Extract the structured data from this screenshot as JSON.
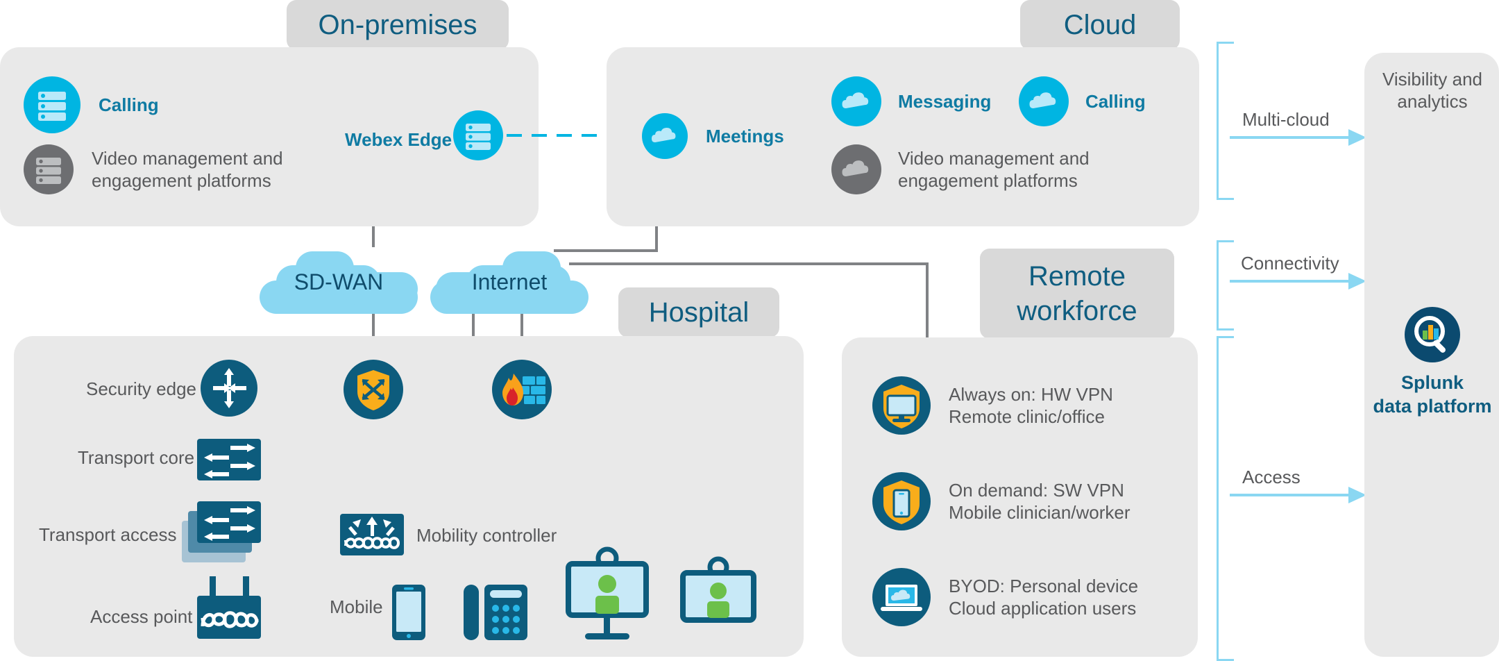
{
  "diagram": {
    "title_colors": {
      "tab_bg": "#d9d9d9",
      "panel_bg": "#e9e9e9",
      "tab_text": "#0f5d80",
      "accent_cyan": "#00b5e2",
      "light_cyan": "#8ad7f2",
      "cisco_blue": "#0d5c7d",
      "gray_text": "#58595b",
      "teal_text": "#0f7ba3",
      "orange": "#f9ad1b",
      "green": "#6cc04a",
      "connector_gray": "#808285",
      "splunk_navy": "#0b4a6f"
    }
  },
  "onprem": {
    "tab_label": "On-premises",
    "items": [
      {
        "label": "Calling",
        "icon": "server-cyan-icon",
        "style": "teal"
      },
      {
        "label": "Video management and\nengagement platforms",
        "icon": "server-gray-icon",
        "style": "gray"
      }
    ],
    "edge": {
      "label": "Webex Edge",
      "icon": "server-cyan-icon"
    }
  },
  "cloud": {
    "tab_label": "Cloud",
    "meetings": {
      "label": "Meetings",
      "icon": "cloud-cyan-icon"
    },
    "items": [
      {
        "label": "Messaging",
        "icon": "cloud-cyan-icon",
        "style": "teal"
      },
      {
        "label": "Calling",
        "icon": "cloud-cyan-icon",
        "style": "teal"
      },
      {
        "label": "Video management and\nengagement platforms",
        "icon": "cloud-gray-icon",
        "style": "gray"
      }
    ]
  },
  "network_clouds": [
    {
      "label": "SD-WAN",
      "icon": "network-cloud-icon"
    },
    {
      "label": "Internet",
      "icon": "network-cloud-icon"
    }
  ],
  "hospital": {
    "tab_label": "Hospital",
    "layers": [
      {
        "label": "Security edge",
        "icon": "router-icon"
      },
      {
        "label": "Transport core",
        "icon": "switch-icon"
      },
      {
        "label": "Transport access",
        "icon": "switch-stack-icon"
      },
      {
        "label": "Access point",
        "icon": "access-point-icon"
      }
    ],
    "security_icons": [
      {
        "name": "sdwan-shield-icon"
      },
      {
        "name": "firewall-icon"
      }
    ],
    "mobility": {
      "label": "Mobility controller",
      "icon": "mobility-controller-icon"
    },
    "endpoints": [
      {
        "label": "Mobile",
        "icon": "mobile-phone-icon"
      },
      {
        "label": "",
        "icon": "desk-phone-icon"
      },
      {
        "label": "",
        "icon": "video-endpoint-stand-icon"
      },
      {
        "label": "",
        "icon": "video-endpoint-icon"
      }
    ]
  },
  "remote": {
    "tab_label": "Remote\nworkforce",
    "items": [
      {
        "icon": "shield-desktop-icon",
        "line1": "Always on: HW VPN",
        "line2": "Remote clinic/office"
      },
      {
        "icon": "shield-mobile-icon",
        "line1": "On demand: SW VPN",
        "line2": "Mobile clinician/worker"
      },
      {
        "icon": "laptop-cloud-icon",
        "line1": "BYOD: Personal device",
        "line2": "Cloud application users"
      }
    ]
  },
  "flows": [
    {
      "label": "Multi-cloud"
    },
    {
      "label": "Connectivity"
    },
    {
      "label": "Access"
    }
  ],
  "analytics": {
    "title_line1": "Visibility and",
    "title_line2": "analytics",
    "product_line1": "Splunk",
    "product_line2": "data platform",
    "icon": "splunk-magnifier-icon"
  }
}
